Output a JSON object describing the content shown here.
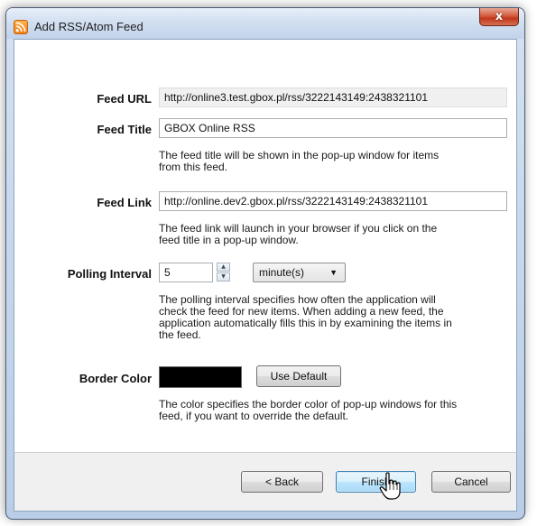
{
  "window": {
    "title": "Add RSS/Atom Feed",
    "close_glyph": "x",
    "icon": "rss-icon"
  },
  "form": {
    "feed_url": {
      "label": "Feed URL",
      "value": "http://online3.test.gbox.pl/rss/3222143149:2438321101"
    },
    "feed_title": {
      "label": "Feed Title",
      "value": "GBOX Online RSS",
      "help_line1": "The feed title will be shown in the pop-up window for items",
      "help_line2": "from this feed."
    },
    "feed_link": {
      "label": "Feed Link",
      "value": "http://online.dev2.gbox.pl/rss/3222143149:2438321101",
      "help_line1": "The feed link will launch in your browser if you click on the",
      "help_line2": "feed title in a pop-up window."
    },
    "polling_interval": {
      "label": "Polling Interval",
      "value": "5",
      "unit_selected": "minute(s)",
      "help_line1": "The polling interval specifies how often the application will",
      "help_line2": "check the feed for new items. When adding a new feed, the",
      "help_line3": "application automatically fills this in by examining the items in",
      "help_line4": "the feed."
    },
    "border_color": {
      "label": "Border Color",
      "value_color": "#000000",
      "use_default_label": "Use Default",
      "help_line1": "The color specifies the border color of pop-up windows for this",
      "help_line2": "feed, if you want to override the default."
    }
  },
  "buttons": {
    "back": "< Back",
    "finish": "Finish",
    "cancel": "Cancel"
  },
  "colors": {
    "title_bar": "#d2dff0",
    "close_button": "#c1381c",
    "default_button": "#a7d9f5"
  }
}
